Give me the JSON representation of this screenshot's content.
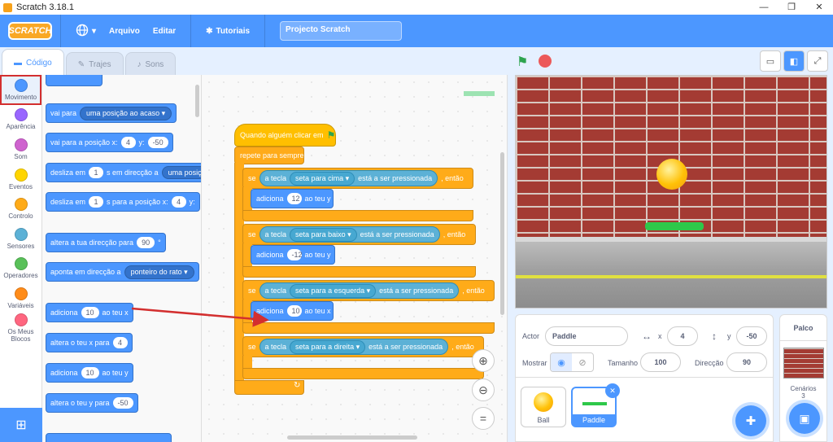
{
  "window": {
    "title": "Scratch 3.18.1",
    "minimize": "—",
    "maximize": "❐",
    "close": "✕"
  },
  "menubar": {
    "logo": "SCRATCH",
    "file": "Arquivo",
    "edit": "Editar",
    "tutorials": "Tutoriais",
    "project_title": "Projecto Scratch"
  },
  "tabs": {
    "code": "Código",
    "costumes": "Trajes",
    "sounds": "Sons"
  },
  "categories": [
    {
      "label": "Movimento",
      "color": "#4c97ff"
    },
    {
      "label": "Aparência",
      "color": "#9966ff"
    },
    {
      "label": "Som",
      "color": "#cf63cf"
    },
    {
      "label": "Eventos",
      "color": "#ffd500"
    },
    {
      "label": "Controlo",
      "color": "#ffab19"
    },
    {
      "label": "Sensores",
      "color": "#5cb1d6"
    },
    {
      "label": "Operadores",
      "color": "#59c059"
    },
    {
      "label": "Variáveis",
      "color": "#ff8c1a"
    },
    {
      "label": "Os Meus Blocos",
      "color": "#ff6680"
    }
  ],
  "palette": {
    "goto": {
      "text": "vai para",
      "drop": "uma posição ao acaso"
    },
    "gotoxy": {
      "text": "vai para a posição x:",
      "x": "4",
      "ylabel": "y:",
      "y": "-50"
    },
    "glide_to": {
      "text": "desliza em",
      "secs": "1",
      "mid": "s em direcção a",
      "drop": "uma posição"
    },
    "glide_xy": {
      "text": "desliza em",
      "secs": "1",
      "mid": "s para a posição x:",
      "x": "4",
      "ylabel": "y:"
    },
    "turn": {
      "text": "altera a tua direcção para",
      "val": "90",
      "unit": "°"
    },
    "point": {
      "text": "aponta em direcção a",
      "drop": "ponteiro do rato"
    },
    "changex": {
      "text": "adiciona",
      "val": "10",
      "suffix": "ao teu x"
    },
    "setx": {
      "text": "altera o teu x para",
      "val": "4"
    },
    "changey": {
      "text": "adiciona",
      "val": "10",
      "suffix": "ao teu y"
    },
    "sety": {
      "text": "altera o teu y para",
      "val": "-50"
    }
  },
  "script": {
    "hat": "Quando alguém clicar em",
    "forever": "repete para sempre",
    "if_label": "se",
    "then": ", então",
    "key_label": "a tecla",
    "pressed": "está a ser pressionada",
    "if1": {
      "key": "seta para cima",
      "action": "adiciona",
      "val": "12",
      "suffix": "ao teu y"
    },
    "if2": {
      "key": "seta para baixo",
      "action": "adiciona",
      "val": "-12",
      "suffix": "ao teu y"
    },
    "if3": {
      "key": "seta para a esquerda",
      "action": "adiciona",
      "val": "10",
      "suffix": "ao teu x"
    },
    "if4": {
      "key": "seta para a direita"
    }
  },
  "sprite_info": {
    "actor_label": "Actor",
    "actor_name": "Paddle",
    "x_label": "x",
    "x": "4",
    "y_label": "y",
    "y": "-50",
    "show_label": "Mostrar",
    "size_label": "Tamanho",
    "size": "100",
    "direction_label": "Direcção",
    "direction": "90"
  },
  "sprites": [
    {
      "name": "Ball"
    },
    {
      "name": "Paddle"
    }
  ],
  "stage_pane": {
    "title": "Palco",
    "backdrops_label": "Cenários",
    "backdrops_count": "3"
  },
  "colors": {
    "accent": "#4c97ff",
    "control": "#ffab19",
    "sensing": "#5cb1d6",
    "annotation": "#d32f2f"
  }
}
